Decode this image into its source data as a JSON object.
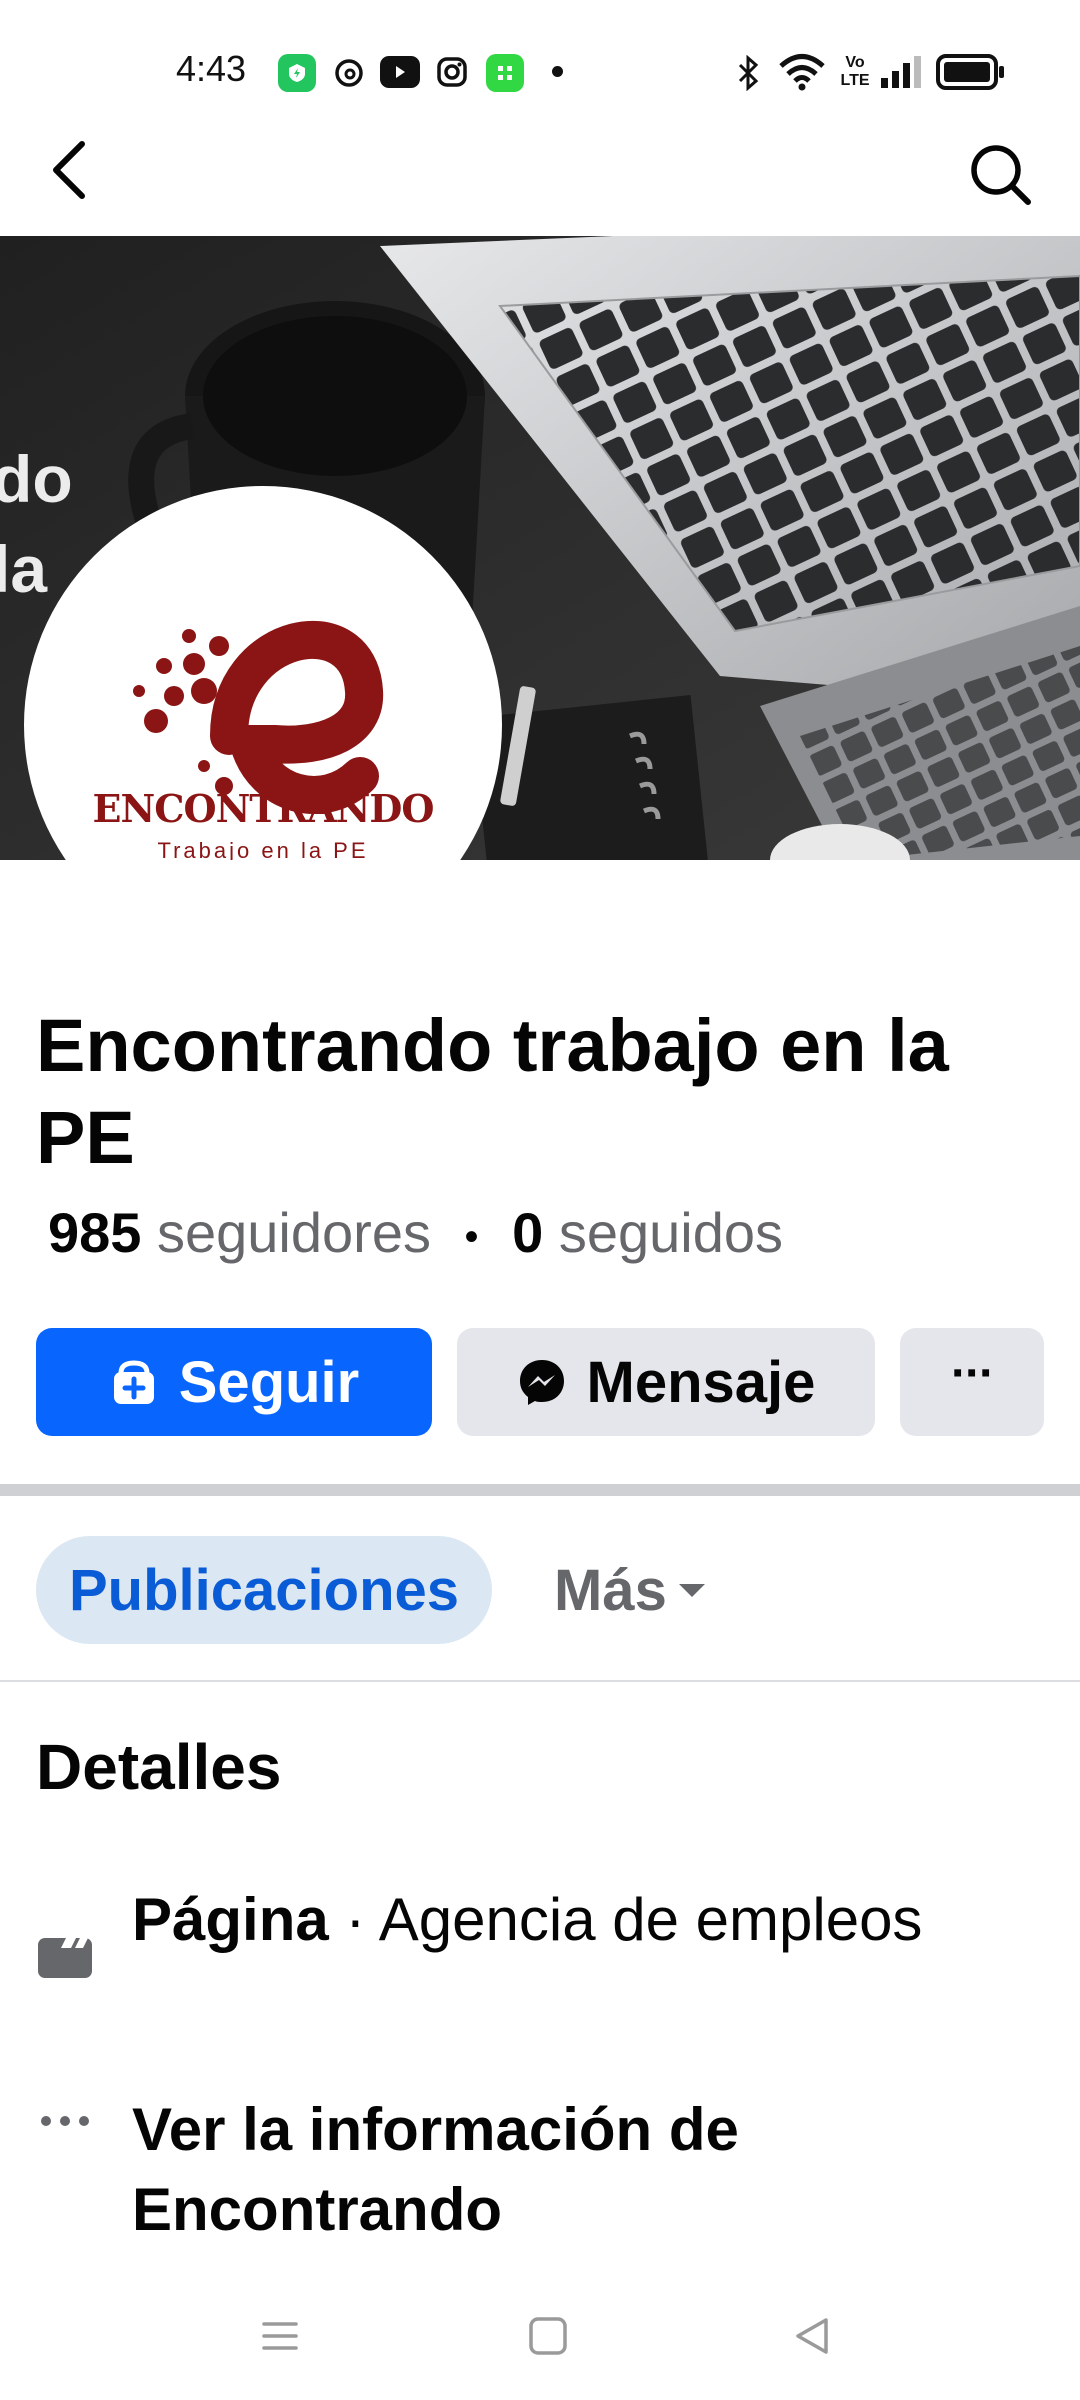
{
  "status_bar": {
    "time": "4:43",
    "left_icons": [
      "app-icon-green",
      "threads-icon",
      "youtube-icon",
      "instagram-icon",
      "app-icon-green-2",
      "dot-icon"
    ],
    "right_icons": [
      "bluetooth-icon",
      "wifi-icon",
      "volte-icon",
      "signal-icon",
      "battery-icon"
    ]
  },
  "nav": {
    "back_icon": "back-arrow-icon",
    "search_icon": "search-icon"
  },
  "cover": {
    "overlay_text_lines": [
      "do",
      "la"
    ]
  },
  "avatar": {
    "logo_word": "ENCONTRANDO",
    "logo_tagline": "Trabajo en la PE"
  },
  "page": {
    "title": "Encontrando trabajo en la PE",
    "followers_count": "985",
    "followers_label": "seguidores",
    "separator": "•",
    "following_count": "0",
    "following_label": "seguidos"
  },
  "actions": {
    "follow_label": "Seguir",
    "message_label": "Mensaje",
    "more_label": "···"
  },
  "tabs": {
    "posts_label": "Publicaciones",
    "more_label": "Más"
  },
  "details": {
    "heading": "Detalles",
    "category_bold": "Página",
    "category_rest": " · Agencia de empleos",
    "info_line1": "Ver la información de",
    "info_line2": "Encontrando"
  },
  "colors": {
    "primary": "#0866ff",
    "secondary_button": "#e4e6eb",
    "tab_active_bg": "#dbe7f2",
    "tab_active_text": "#0a5bd6",
    "muted_text": "#65676b",
    "logo_red": "#8b1414"
  }
}
